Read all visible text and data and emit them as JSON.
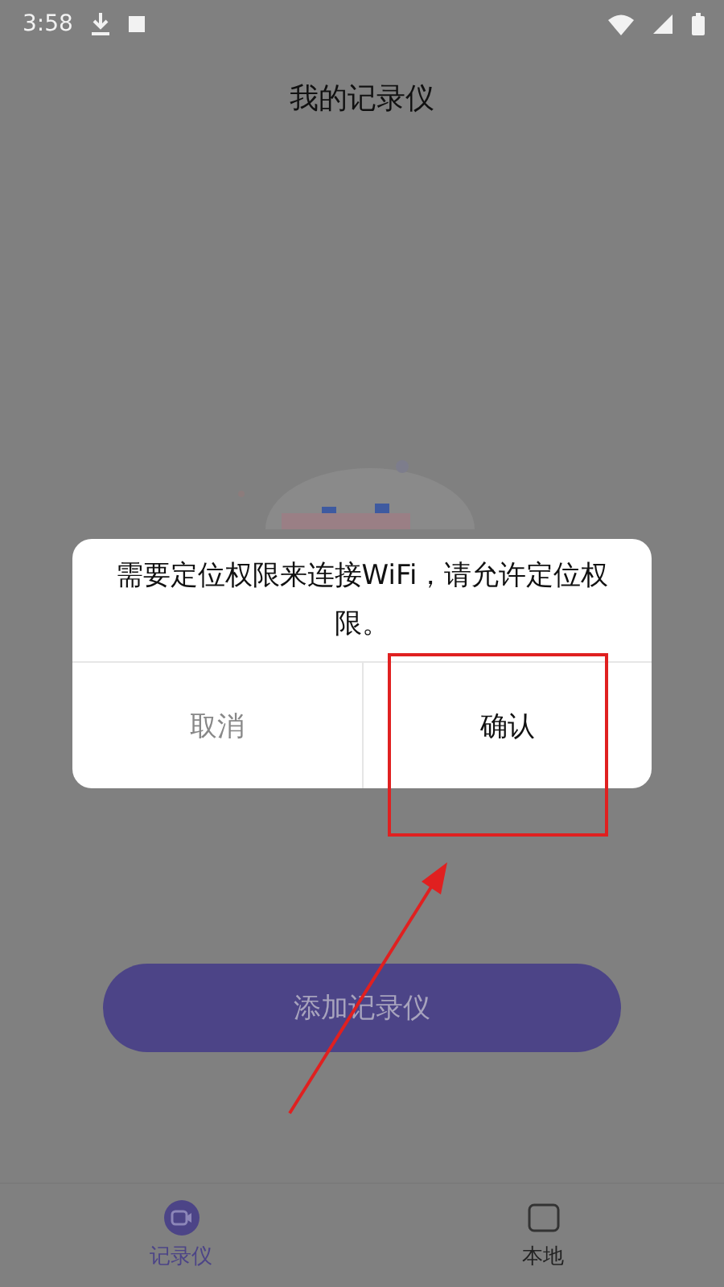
{
  "status_bar": {
    "time": "3:58"
  },
  "header": {
    "title": "我的记录仪"
  },
  "dialog": {
    "message": "需要定位权限来连接WiFi，请允许定位权限。",
    "buttons": [
      {
        "label": "取消",
        "kind": "cancel"
      },
      {
        "label": "确认",
        "kind": "confirm"
      }
    ]
  },
  "add_button": {
    "label": "添加记录仪"
  },
  "tabs": [
    {
      "label": "记录仪",
      "selected": true
    },
    {
      "label": "本地",
      "selected": false
    }
  ]
}
